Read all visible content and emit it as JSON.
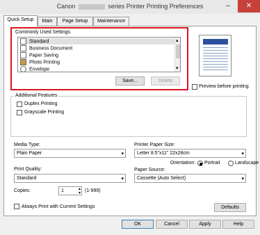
{
  "window": {
    "title_prefix": "Canon",
    "title_suffix": "series Printer Printing Preferences",
    "minimize_glyph": "–",
    "close_glyph": "✕"
  },
  "tabs": [
    {
      "label": "Quick Setup"
    },
    {
      "label": "Main"
    },
    {
      "label": "Page Setup"
    },
    {
      "label": "Maintenance"
    }
  ],
  "commonly_used": {
    "label": "Commonly Used Settings",
    "items": [
      {
        "label": "Standard",
        "icon": "standard-icon"
      },
      {
        "label": "Business Document",
        "icon": "document-icon"
      },
      {
        "label": "Paper Saving",
        "icon": "paper-saving-icon"
      },
      {
        "label": "Photo Printing",
        "icon": "photo-icon"
      },
      {
        "label": "Envelope",
        "icon": "envelope-icon"
      }
    ],
    "save_label": "Save...",
    "delete_label": "Delete"
  },
  "preview_label": "Preview before printing",
  "additional_features": {
    "label": "Additional Features",
    "duplex_label": "Duplex Printing",
    "grayscale_label": "Grayscale Printing"
  },
  "media_type": {
    "label": "Media Type:",
    "value": "Plain Paper"
  },
  "printer_paper_size": {
    "label": "Printer Paper Size:",
    "value": "Letter 8.5\"x11\" 22x28cm"
  },
  "orientation": {
    "label": "Orientation:",
    "portrait": "Portrait",
    "landscape": "Landscape",
    "selected": "Portrait"
  },
  "print_quality": {
    "label": "Print Quality:",
    "value": "Standard"
  },
  "paper_source": {
    "label": "Paper Source:",
    "value": "Cassette (Auto Select)"
  },
  "copies": {
    "label": "Copies:",
    "value": "1",
    "range": "(1-999)"
  },
  "always_print_label": "Always Print with Current Settings",
  "buttons": {
    "defaults": "Defaults",
    "ok": "OK",
    "cancel": "Cancel",
    "apply": "Apply",
    "help": "Help"
  },
  "icons": {
    "dropdown": "▾",
    "scroll_up": "▴",
    "scroll_down": "▾",
    "spin_up": "▴",
    "spin_down": "▾"
  }
}
